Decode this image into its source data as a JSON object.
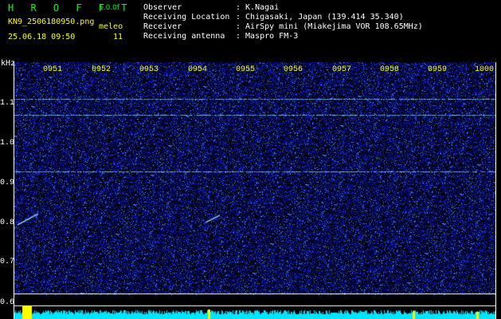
{
  "header": {
    "brand": "H R O F F T",
    "version": "1.0.0f",
    "filename": "KN9_2506180950.png",
    "datetime": "25.06.18 09:50",
    "source": "meleo",
    "count": "11",
    "info": [
      {
        "label": "Observer",
        "value": ": K.Nagai"
      },
      {
        "label": "Receiving Location",
        "value": ": Chigasaki, Japan (139.414 35.340)"
      },
      {
        "label": "Receiver",
        "value": ": AirSpy mini (Miakejima VOR 108.65MHz)"
      },
      {
        "label": "Receiving antenna",
        "value": ": Maspro FM-3"
      }
    ]
  },
  "axis": {
    "unit": "kHz",
    "y_labels": [
      "1.1",
      "1.0",
      "0.9",
      "0.8",
      "0.7",
      "0.6"
    ],
    "time_labels": [
      "0951",
      "0952",
      "0953",
      "0954",
      "0955",
      "0956",
      "0957",
      "0958",
      "0959",
      "1000"
    ]
  },
  "colors": {
    "background": "#000000",
    "noise": "#0a1a8c",
    "carrier": "#7fd7ff",
    "level": "#00e5ff",
    "marker": "#ffff00",
    "text_yellow": "#ffff00",
    "text_green": "#00ff00"
  }
}
